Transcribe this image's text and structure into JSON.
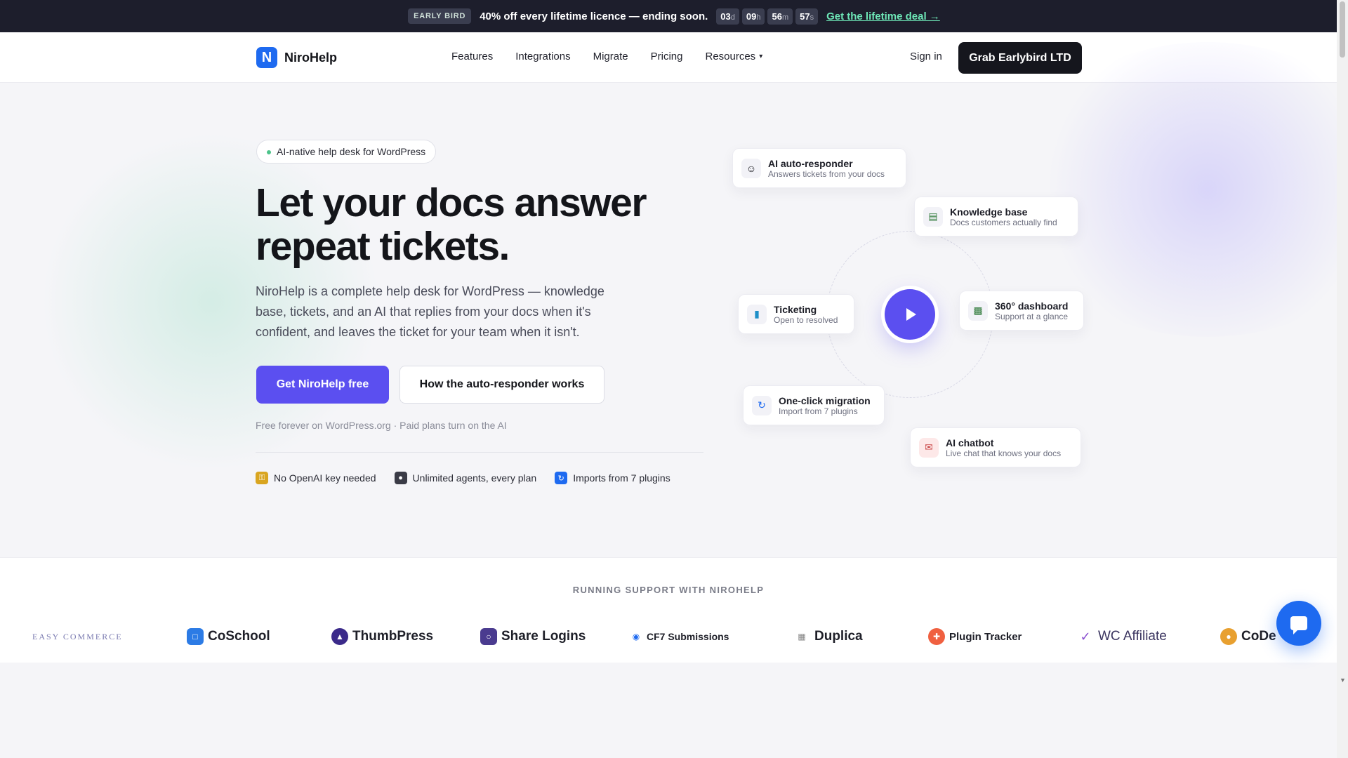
{
  "promo": {
    "badge": "EARLY BIRD",
    "message": "40% off every lifetime licence — ending soon.",
    "timer": [
      {
        "value": "03",
        "unit": "d"
      },
      {
        "value": "09",
        "unit": "h"
      },
      {
        "value": "56",
        "unit": "m"
      },
      {
        "value": "57",
        "unit": "s"
      }
    ],
    "deal_link": "Get the lifetime deal →"
  },
  "nav": {
    "brand": "NiroHelp",
    "links": [
      "Features",
      "Integrations",
      "Migrate",
      "Pricing",
      "Resources"
    ],
    "signin": "Sign in",
    "cta": "Grab Earlybird LTD"
  },
  "hero": {
    "pill": "AI-native help desk for WordPress",
    "headline_1": "Let your docs answer",
    "headline_2": "repeat tickets.",
    "sub": "NiroHelp is a complete help desk for WordPress — knowledge base, tickets, and an AI that replies from your docs when it's confident, and leaves the ticket for your team when it isn't.",
    "primary_btn": "Get NiroHelp free",
    "secondary_btn": "How the auto-responder works",
    "note": "Free forever on WordPress.org · Paid plans turn on the AI",
    "features": [
      {
        "icon": "key-icon",
        "label": "No OpenAI key needed"
      },
      {
        "icon": "users-icon",
        "label": "Unlimited agents, every plan"
      },
      {
        "icon": "import-icon",
        "label": "Imports from 7 plugins"
      }
    ]
  },
  "diagram": {
    "cards": [
      {
        "icon": "robot-icon",
        "title": "AI auto-responder",
        "sub": "Answers tickets from your docs"
      },
      {
        "icon": "book-icon",
        "title": "Knowledge base",
        "sub": "Docs customers actually find"
      },
      {
        "icon": "ticket-icon",
        "title": "Ticketing",
        "sub": "Open to resolved"
      },
      {
        "icon": "chart-icon",
        "title": "360° dashboard",
        "sub": "Support at a glance"
      },
      {
        "icon": "migrate-icon",
        "title": "One-click migration",
        "sub": "Import from 7 plugins"
      },
      {
        "icon": "chat-icon",
        "title": "AI chatbot",
        "sub": "Live chat that knows your docs"
      }
    ]
  },
  "customers": {
    "title": "RUNNING SUPPORT WITH NIROHELP",
    "logos": [
      "EASY COMMERCE",
      "CoSchool",
      "ThumbPress",
      "Share Logins",
      "CF7 Submissions",
      "Duplica",
      "Plugin Tracker",
      "WC Affiliate",
      "CoDe"
    ]
  },
  "colors": {
    "accent": "#5b4ff0",
    "brand_blue": "#1e6af0",
    "promo_bg": "#1d1e2c",
    "deal_green": "#6ee7b7"
  }
}
